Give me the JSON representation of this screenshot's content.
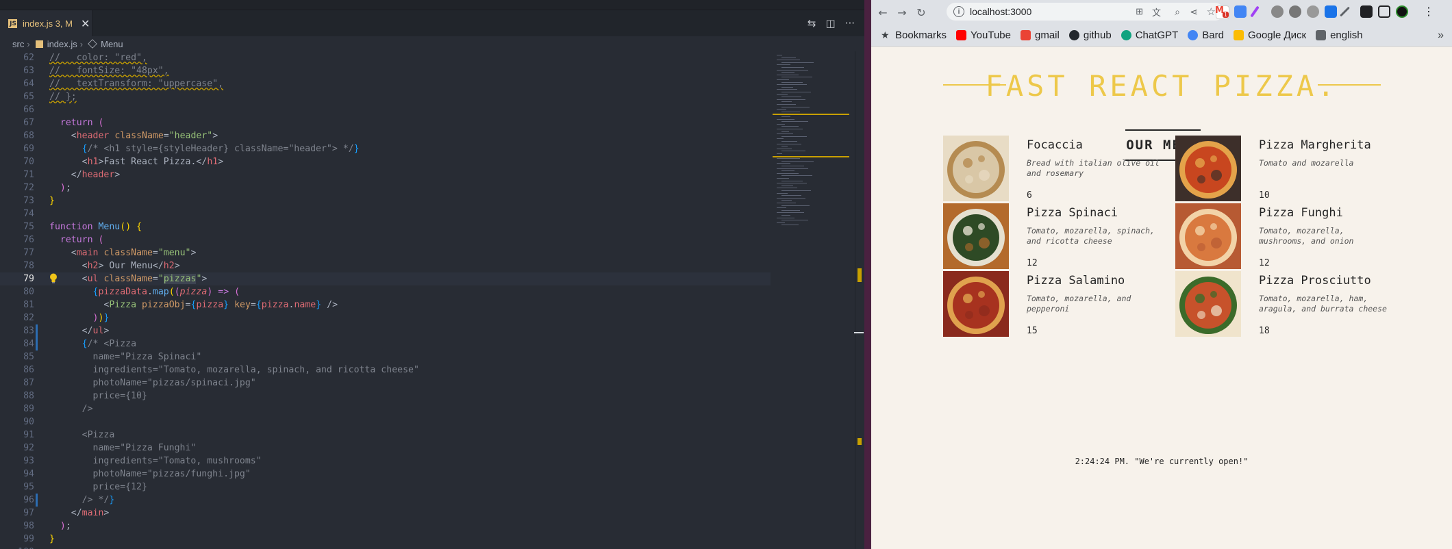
{
  "editor": {
    "tab": {
      "icon": "js-file-icon",
      "label": "index.js 3, M"
    },
    "actions": [
      "compare-icon",
      "split-editor-icon",
      "more-actions-icon"
    ],
    "breadcrumb": [
      "src",
      "index.js",
      "Menu"
    ],
    "lines": [
      {
        "n": "62",
        "html": "<span class='cw'>//   color: \"red\",</span>"
      },
      {
        "n": "63",
        "html": "<span class='cw'>//   fontSize: \"48px\",</span>"
      },
      {
        "n": "64",
        "html": "<span class='cw'>//   textTransform: \"uppercase\",</span>"
      },
      {
        "n": "65",
        "html": "<span class='cw'>// };</span>"
      },
      {
        "n": "66",
        "html": ""
      },
      {
        "n": "67",
        "html": "  <span class='k'>return</span> <span class='b2'>(</span>"
      },
      {
        "n": "68",
        "html": "    <span class='p'>&lt;</span><span class='t'>header</span> <span class='a'>className</span><span class='p'>=</span><span class='s'>\"header\"</span><span class='p'>&gt;</span>"
      },
      {
        "n": "69",
        "html": "      <span class='b3'>{</span><span class='c'>/* &lt;h1 style={styleHeader} className=\"header\"&gt; */</span><span class='b3'>}</span>"
      },
      {
        "n": "70",
        "html": "      <span class='p'>&lt;</span><span class='t'>h1</span><span class='p'>&gt;</span>Fast React Pizza.<span class='p'>&lt;/</span><span class='t'>h1</span><span class='p'>&gt;</span>"
      },
      {
        "n": "71",
        "html": "    <span class='p'>&lt;/</span><span class='t'>header</span><span class='p'>&gt;</span>"
      },
      {
        "n": "72",
        "html": "  <span class='b2'>)</span>;"
      },
      {
        "n": "73",
        "html": "<span class='b1'>}</span>"
      },
      {
        "n": "74",
        "html": ""
      },
      {
        "n": "75",
        "html": "<span class='k'>function</span> <span class='f'>Menu</span><span class='b1'>()</span> <span class='b1'>{</span>"
      },
      {
        "n": "76",
        "html": "  <span class='k'>return</span> <span class='b2'>(</span>"
      },
      {
        "n": "77",
        "html": "    <span class='p'>&lt;</span><span class='t'>main</span> <span class='a'>className</span><span class='p'>=</span><span class='s'>\"menu\"</span><span class='p'>&gt;</span>"
      },
      {
        "n": "78",
        "html": "      <span class='p'>&lt;</span><span class='t'>h2</span><span class='p'>&gt;</span> Our Menu<span class='p'>&lt;/</span><span class='t'>h2</span><span class='p'>&gt;</span>"
      },
      {
        "n": "79",
        "html": "      <span class='p'>&lt;</span><span class='t'>ul</span> <span class='a'>className</span><span class='p'>=</span><span class='s'>\"<span class='hl'>pizzas</span>\"</span><span class='p'>&gt;</span>",
        "cur": true
      },
      {
        "n": "80",
        "html": "        <span class='b3'>{</span><span class='v'>pizzaData</span>.<span class='f'>map</span><span class='b1'>(</span><span class='b2'>(</span><span class='vi'>pizza</span><span class='b2'>)</span> <span class='k'>=&gt;</span> <span class='b2'>(</span>"
      },
      {
        "n": "81",
        "html": "          <span class='p'>&lt;</span><span class='s'>Pizza</span> <span class='a'>pizzaObj</span><span class='p'>=</span><span class='b3'>{</span><span class='v'>pizza</span><span class='b3'>}</span> <span class='a'>key</span><span class='p'>=</span><span class='b3'>{</span><span class='v'>pizza</span>.<span class='v'>name</span><span class='b3'>}</span> <span class='p'>/&gt;</span>"
      },
      {
        "n": "82",
        "html": "        <span class='b2'>)</span><span class='b1'>)</span><span class='b3'>}</span>"
      },
      {
        "n": "83",
        "html": "      <span class='p'>&lt;/</span><span class='t'>ul</span><span class='p'>&gt;</span>"
      },
      {
        "n": "84",
        "html": "      <span class='b3'>{</span><span class='c'>/* &lt;Pizza</span>"
      },
      {
        "n": "85",
        "html": "<span class='c'>        name=\"Pizza Spinaci\"</span>"
      },
      {
        "n": "86",
        "html": "<span class='c'>        ingredients=\"Tomato, mozarella, spinach, and ricotta cheese\"</span>"
      },
      {
        "n": "87",
        "html": "<span class='c'>        photoName=\"pizzas/spinaci.jpg\"</span>"
      },
      {
        "n": "88",
        "html": "<span class='c'>        price={10}</span>"
      },
      {
        "n": "89",
        "html": "<span class='c'>      /&gt;</span>"
      },
      {
        "n": "90",
        "html": ""
      },
      {
        "n": "91",
        "html": "<span class='c'>      &lt;Pizza</span>"
      },
      {
        "n": "92",
        "html": "<span class='c'>        name=\"Pizza Funghi\"</span>"
      },
      {
        "n": "93",
        "html": "<span class='c'>        ingredients=\"Tomato, mushrooms\"</span>"
      },
      {
        "n": "94",
        "html": "<span class='c'>        photoName=\"pizzas/funghi.jpg\"</span>"
      },
      {
        "n": "95",
        "html": "<span class='c'>        price={12}</span>"
      },
      {
        "n": "96",
        "html": "<span class='c'>      /&gt; */</span><span class='b3'>}</span>"
      },
      {
        "n": "97",
        "html": "    <span class='p'>&lt;/</span><span class='t'>main</span><span class='p'>&gt;</span>"
      },
      {
        "n": "98",
        "html": "  <span class='b2'>)</span>;"
      },
      {
        "n": "99",
        "html": "<span class='b1'>}</span>"
      },
      {
        "n": "100",
        "html": ""
      }
    ]
  },
  "browser": {
    "url": "localhost:3000",
    "bookmarks": [
      {
        "label": "Bookmarks",
        "icon": "star-icon",
        "color": "#3c4043"
      },
      {
        "label": "YouTube",
        "icon": "youtube-icon",
        "color": "#ff0000"
      },
      {
        "label": "gmail",
        "icon": "gmail-icon",
        "color": "#ea4335"
      },
      {
        "label": "github",
        "icon": "github-icon",
        "color": "#24292e"
      },
      {
        "label": "ChatGPT",
        "icon": "chatgpt-icon",
        "color": "#10a37f"
      },
      {
        "label": "Bard",
        "icon": "bard-icon",
        "color": "#4285f4"
      },
      {
        "label": "Google Диск",
        "icon": "google-drive-icon",
        "color": "#fbbc04"
      },
      {
        "label": "english",
        "icon": "folder-icon",
        "color": "#5f6368"
      }
    ],
    "extensions": [
      "gmail-badge-icon",
      "translate-icon",
      "zoom-icon",
      "share-icon",
      "star-icon",
      "ext-1-icon",
      "ext-2-icon",
      "ext-3-icon",
      "ext-4-icon",
      "ext-5-icon",
      "ext-6-icon",
      "puzzle-icon",
      "sidebar-icon",
      "profile-icon"
    ],
    "page": {
      "title": "Fast React Pizza.",
      "menu_heading": "Our Menu",
      "pizzas": [
        {
          "name": "Focaccia",
          "ingredients": "Bread with italian olive oil and rosemary",
          "price": "6",
          "palette": [
            "#d9c7a6",
            "#b58b51",
            "#e8dcc5"
          ]
        },
        {
          "name": "Pizza Margherita",
          "ingredients": "Tomato and mozarella",
          "price": "10",
          "palette": [
            "#c8461f",
            "#e4a34a",
            "#3d2f2a"
          ]
        },
        {
          "name": "Pizza Spinaci",
          "ingredients": "Tomato, mozarella, spinach, and ricotta cheese",
          "price": "12",
          "palette": [
            "#2e4a25",
            "#e5e0d0",
            "#b36a2c"
          ]
        },
        {
          "name": "Pizza Funghi",
          "ingredients": "Tomato, mozarella, mushrooms, and onion",
          "price": "12",
          "palette": [
            "#d9793f",
            "#f2d3a8",
            "#b75a33"
          ]
        },
        {
          "name": "Pizza Salamino",
          "ingredients": "Tomato, mozarella, and pepperoni",
          "price": "15",
          "palette": [
            "#a7321f",
            "#e0a24e",
            "#8a2a1d"
          ]
        },
        {
          "name": "Pizza Prosciutto",
          "ingredients": "Tomato, mozarella, ham, aragula, and burrata cheese",
          "price": "18",
          "palette": [
            "#c7522b",
            "#3b6b2a",
            "#f0e4cc"
          ]
        }
      ],
      "footer": "2:24:24 PM. \"We're currently open!\""
    }
  }
}
